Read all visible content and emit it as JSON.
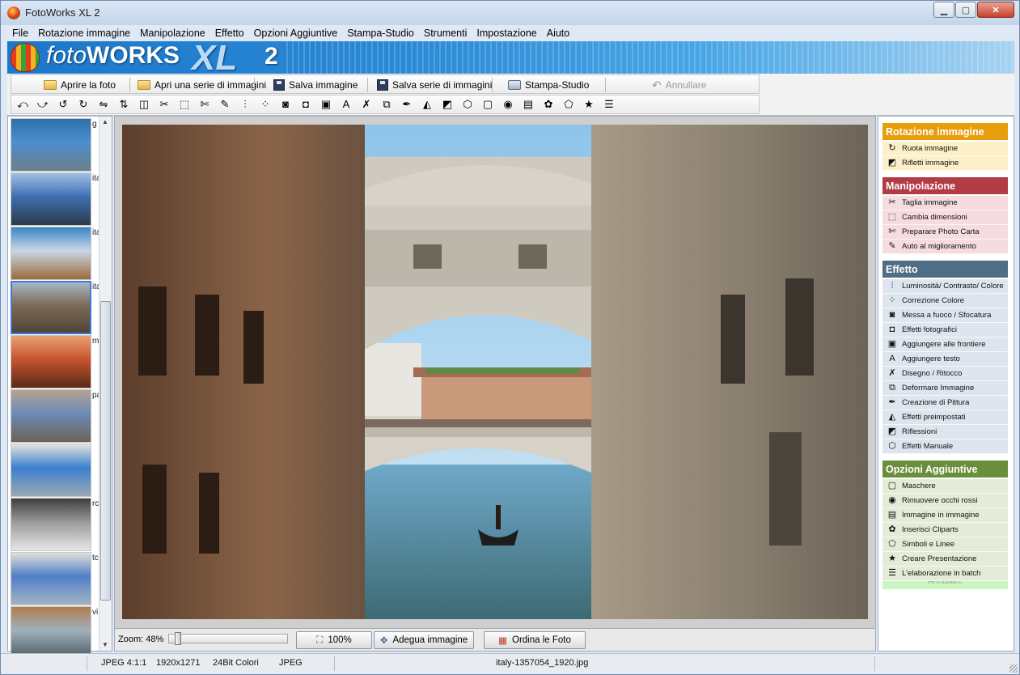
{
  "window": {
    "title": "FotoWorks XL 2",
    "minimize_glyph": "▁",
    "maximize_glyph": "▢",
    "close_glyph": "✕"
  },
  "menu": [
    {
      "label": "File"
    },
    {
      "label": "Rotazione immagine"
    },
    {
      "label": "Manipolazione"
    },
    {
      "label": "Effetto"
    },
    {
      "label": "Opzioni Aggiuntive"
    },
    {
      "label": "Stampa-Studio"
    },
    {
      "label": "Strumenti"
    },
    {
      "label": "Impostazione"
    },
    {
      "label": "Aiuto"
    }
  ],
  "banner": {
    "brand_light": "foto",
    "brand_bold": "WORKS",
    "brand_xl": "XL",
    "brand_version": "2"
  },
  "toolbar": {
    "open_photo": "Aprire la foto",
    "open_series": "Apri una serie di immagini",
    "save_image": "Salva immagine",
    "save_series": "Salva serie di immagini",
    "print_studio": "Stampa-Studio",
    "undo": "Annullare"
  },
  "tool_icons": [
    {
      "name": "rotate-left-icon",
      "glyph": "⤺"
    },
    {
      "name": "rotate-right-icon",
      "glyph": "⤻"
    },
    {
      "name": "rotate-ccw-icon",
      "glyph": "↺"
    },
    {
      "name": "rotate-cw-icon",
      "glyph": "↻"
    },
    {
      "name": "flip-horizontal-icon",
      "glyph": "⇋"
    },
    {
      "name": "flip-vertical-icon",
      "glyph": "⇅"
    },
    {
      "name": "mirror-icon",
      "glyph": "◫"
    },
    {
      "name": "scissors-icon",
      "glyph": "✂"
    },
    {
      "name": "resize-icon",
      "glyph": "⬚"
    },
    {
      "name": "crop-photo-icon",
      "glyph": "✄"
    },
    {
      "name": "magic-wand-icon",
      "glyph": "✎"
    },
    {
      "name": "levels-icon",
      "glyph": "⫶"
    },
    {
      "name": "color-dots-icon",
      "glyph": "⁘"
    },
    {
      "name": "focus-icon",
      "glyph": "◙"
    },
    {
      "name": "camera-icon",
      "glyph": "◘"
    },
    {
      "name": "frame-icon",
      "glyph": "▣"
    },
    {
      "name": "text-icon",
      "glyph": "A"
    },
    {
      "name": "draw-icon",
      "glyph": "✗"
    },
    {
      "name": "deform-icon",
      "glyph": "⧉"
    },
    {
      "name": "paint-icon",
      "glyph": "✒"
    },
    {
      "name": "presets-icon",
      "glyph": "◭"
    },
    {
      "name": "reflection-icon",
      "glyph": "◩"
    },
    {
      "name": "manual-effects-icon",
      "glyph": "⬡"
    },
    {
      "name": "mask-icon",
      "glyph": "▢"
    },
    {
      "name": "red-eye-icon",
      "glyph": "◉"
    },
    {
      "name": "picture-in-picture-icon",
      "glyph": "▤"
    },
    {
      "name": "clipart-icon",
      "glyph": "✿"
    },
    {
      "name": "symbols-icon",
      "glyph": "⬠"
    },
    {
      "name": "star-icon",
      "glyph": "★"
    },
    {
      "name": "batch-icon",
      "glyph": "☰"
    }
  ],
  "thumbnails": [
    {
      "caption": "g",
      "colors": [
        "#4d8fcf",
        "#2c6fa8",
        "#6a7f8a"
      ]
    },
    {
      "caption": "ita",
      "colors": [
        "#3f6fb2",
        "#9fc0e6",
        "#2c3a4a"
      ]
    },
    {
      "caption": "ita",
      "colors": [
        "#c9d7e6",
        "#3a86c6",
        "#9b6a3a"
      ]
    },
    {
      "caption": "ita",
      "colors": [
        "#7d6a58",
        "#a8b8c4",
        "#4f4438"
      ]
    },
    {
      "caption": "m",
      "colors": [
        "#c7552f",
        "#e8a070",
        "#5a2a18"
      ]
    },
    {
      "caption": "pa",
      "colors": [
        "#6b8bb8",
        "#b5a48f",
        "#6b6355"
      ]
    },
    {
      "caption": "",
      "colors": [
        "#3a7fcf",
        "#e5e3df",
        "#9aa8b3"
      ]
    },
    {
      "caption": "rc",
      "colors": [
        "#9a9a9a",
        "#3e3e3e",
        "#e6e6e6"
      ]
    },
    {
      "caption": "tc",
      "colors": [
        "#4f7fc7",
        "#e2e0da",
        "#a3b3c4"
      ]
    },
    {
      "caption": "vi",
      "colors": [
        "#9fb0bd",
        "#b27d4f",
        "#4d5a60"
      ]
    }
  ],
  "viewer": {
    "zoom_label": "Zoom: 48%",
    "zoom_value": 48,
    "btn_100": "100%",
    "btn_fit": "Adegua immagine",
    "btn_sort": "Ordina le Foto"
  },
  "sidepanel": {
    "sections": [
      {
        "title": "Rotazione immagine",
        "head_color": "#e89e0c",
        "item_color": "#fdf0c8",
        "items": [
          {
            "label": "Ruota immagine",
            "icon": "↻"
          },
          {
            "label": "Rifletti immagine",
            "icon": "◩"
          }
        ]
      },
      {
        "title": "Manipolazione",
        "head_color": "#b33b46",
        "item_color": "#f6dcde",
        "items": [
          {
            "label": "Taglia immagine",
            "icon": "✂"
          },
          {
            "label": "Cambia dimensioni",
            "icon": "⬚"
          },
          {
            "label": "Preparare Photo Carta",
            "icon": "✄"
          },
          {
            "label": "Auto al miglioramento",
            "icon": "✎"
          }
        ]
      },
      {
        "title": "Effetto",
        "head_color": "#4f6d84",
        "item_color": "#dde6ee",
        "items": [
          {
            "label": "Luminosità/ Contrasto/ Colore",
            "icon": "⫶"
          },
          {
            "label": "Correzione Colore",
            "icon": "⁘"
          },
          {
            "label": "Messa a fuoco / Sfocatura",
            "icon": "◙"
          },
          {
            "label": "Effetti fotografici",
            "icon": "◘"
          },
          {
            "label": "Aggiungere alle frontiere",
            "icon": "▣"
          },
          {
            "label": "Aggiungere testo",
            "icon": "A"
          },
          {
            "label": "Disegno / Ritocco",
            "icon": "✗"
          },
          {
            "label": "Deformare Immagine",
            "icon": "⧉"
          },
          {
            "label": "Creazione di Pittura",
            "icon": "✒"
          },
          {
            "label": "Effetti preimpostati",
            "icon": "◭"
          },
          {
            "label": "Riflessioni",
            "icon": "◩"
          },
          {
            "label": "Effetti Manuale",
            "icon": "⬡"
          }
        ]
      },
      {
        "title": "Opzioni Aggiuntive",
        "head_color": "#6a8f3c",
        "item_color": "#e3ecd6",
        "items": [
          {
            "label": "Maschere",
            "icon": "▢"
          },
          {
            "label": "Rimuovere occhi rossi",
            "icon": "◉"
          },
          {
            "label": "Immagine in immagine",
            "icon": "▤"
          },
          {
            "label": "Inserisci Cliparts",
            "icon": "✿"
          },
          {
            "label": "Simboli e Linee",
            "icon": "⬠"
          },
          {
            "label": "Creare Presentazione",
            "icon": "★"
          },
          {
            "label": "L'elaborazione in batch",
            "icon": "☰"
          }
        ]
      }
    ],
    "undo": "Annullare"
  },
  "status": {
    "format": "JPEG  4:1:1",
    "size": "1920x1271",
    "colors": "24Bit Colori",
    "type": "JPEG",
    "filename": "italy-1357054_1920.jpg"
  }
}
